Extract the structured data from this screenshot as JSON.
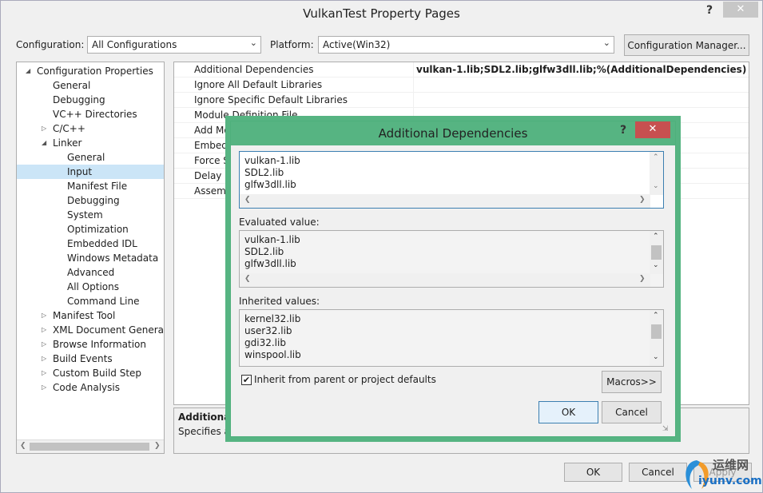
{
  "window": {
    "title": "VulkanTest Property Pages",
    "help": "?",
    "close": "✕"
  },
  "toolbar": {
    "configuration_label": "Configuration:",
    "configuration_value": "All Configurations",
    "platform_label": "Platform:",
    "platform_value": "Active(Win32)",
    "config_manager_label": "Configuration Manager..."
  },
  "tree": {
    "items": [
      {
        "label": "Configuration Properties",
        "expander": "◢"
      },
      {
        "label": "General"
      },
      {
        "label": "Debugging"
      },
      {
        "label": "VC++ Directories"
      },
      {
        "label": "C/C++",
        "expander": "▷"
      },
      {
        "label": "Linker",
        "expander": "◢"
      },
      {
        "label": "General"
      },
      {
        "label": "Input"
      },
      {
        "label": "Manifest File"
      },
      {
        "label": "Debugging"
      },
      {
        "label": "System"
      },
      {
        "label": "Optimization"
      },
      {
        "label": "Embedded IDL"
      },
      {
        "label": "Windows Metadata"
      },
      {
        "label": "Advanced"
      },
      {
        "label": "All Options"
      },
      {
        "label": "Command Line"
      },
      {
        "label": "Manifest Tool",
        "expander": "▷"
      },
      {
        "label": "XML Document Generator",
        "expander": "▷"
      },
      {
        "label": "Browse Information",
        "expander": "▷"
      },
      {
        "label": "Build Events",
        "expander": "▷"
      },
      {
        "label": "Custom Build Step",
        "expander": "▷"
      },
      {
        "label": "Code Analysis",
        "expander": "▷"
      }
    ],
    "selected": "Input"
  },
  "grid": {
    "rows": [
      {
        "name": "Additional Dependencies",
        "value": "vulkan-1.lib;SDL2.lib;glfw3dll.lib;%(AdditionalDependencies)"
      },
      {
        "name": "Ignore All Default Libraries",
        "value": ""
      },
      {
        "name": "Ignore Specific Default Libraries",
        "value": ""
      },
      {
        "name": "Module Definition File",
        "value": ""
      },
      {
        "name": "Add Moc",
        "value": ""
      },
      {
        "name": "Embed M",
        "value": ""
      },
      {
        "name": "Force Syr",
        "value": ""
      },
      {
        "name": "Delay Lo",
        "value": ""
      },
      {
        "name": "Assembl",
        "value": ""
      }
    ]
  },
  "description": {
    "title": "Additional D",
    "text": "Specifies add"
  },
  "footer": {
    "ok_label": "OK",
    "cancel_label": "Cancel",
    "apply_label": "Apply"
  },
  "dialog": {
    "title": "Additional Dependencies",
    "help": "?",
    "close": "✕",
    "edit_lines": [
      "vulkan-1.lib",
      "SDL2.lib",
      "glfw3dll.lib"
    ],
    "evaluated_label": "Evaluated value:",
    "evaluated_lines": [
      "vulkan-1.lib",
      "SDL2.lib",
      "glfw3dll.lib"
    ],
    "inherited_label": "Inherited values:",
    "inherited_lines": [
      "kernel32.lib",
      "user32.lib",
      "gdi32.lib",
      "winspool.lib"
    ],
    "inherit_checkbox_label": "Inherit from parent or project defaults",
    "inherit_checked": true,
    "macros_label": "Macros>>",
    "ok_label": "OK",
    "cancel_label": "Cancel"
  },
  "watermark": {
    "cn": "运维网",
    "url": "iyunv.com"
  }
}
